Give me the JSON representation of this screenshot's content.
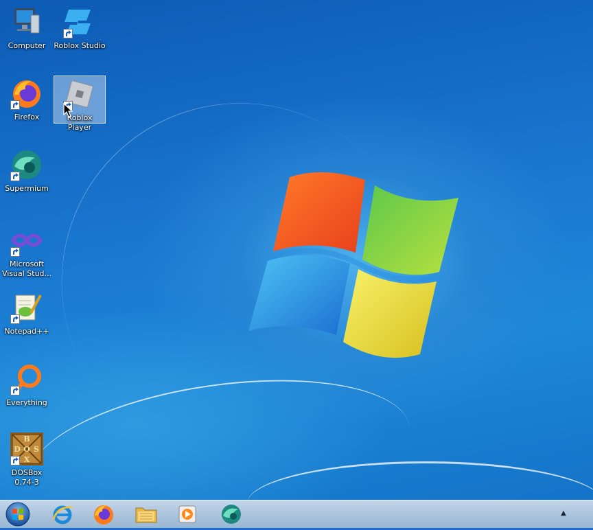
{
  "desktop": {
    "icons": [
      {
        "label": "Computer",
        "icon": "computer-icon"
      },
      {
        "label": "Roblox Studio",
        "icon": "roblox-studio-icon"
      },
      {
        "label": "Firefox",
        "icon": "firefox-icon"
      },
      {
        "label": "Roblox Player",
        "icon": "roblox-player-icon"
      },
      {
        "label": "Supermium",
        "icon": "supermium-icon"
      },
      {
        "label": "Microsoft Visual Studio",
        "line1": "Microsoft",
        "line2": "Visual Stud...",
        "icon": "visual-studio-icon"
      },
      {
        "label": "Notepad++",
        "icon": "notepadpp-icon"
      },
      {
        "label": "Everything",
        "icon": "everything-icon"
      },
      {
        "label": "DOSBox 0.74-3",
        "line1": "DOSBox",
        "line2": "0.74-3",
        "icon": "dosbox-icon"
      }
    ],
    "selected_icon": "Roblox Player",
    "dosbox_logo": {
      "a": "B",
      "b": "D",
      "c": "O",
      "d": "S",
      "e": "X"
    }
  },
  "taskbar": {
    "start": "start-orb-icon",
    "pinned": [
      "internet-explorer-icon",
      "firefox-icon",
      "file-explorer-icon",
      "media-player-icon",
      "supermium-icon"
    ],
    "tray_arrow": "▲"
  },
  "colors": {
    "accent": "#1b6ccc",
    "taskbar": "#aec6de"
  }
}
